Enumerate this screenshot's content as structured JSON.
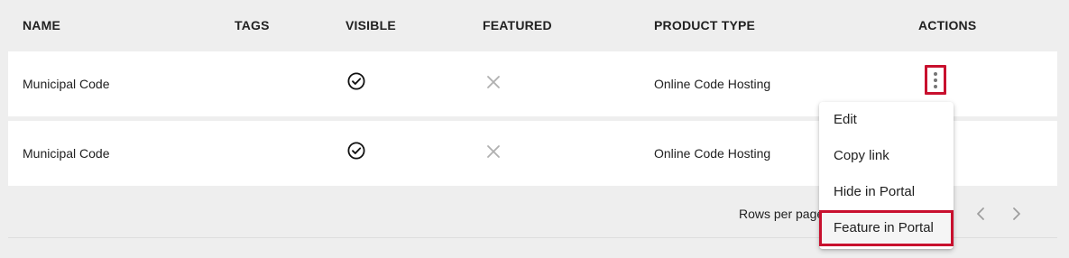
{
  "table": {
    "headers": {
      "name": "NAME",
      "tags": "TAGS",
      "visible": "VISIBLE",
      "featured": "FEATURED",
      "product_type": "PRODUCT TYPE",
      "actions": "ACTIONS"
    },
    "rows": [
      {
        "name": "Municipal Code",
        "tags": "",
        "visible": "check-circle-icon",
        "featured": "close-icon",
        "product_type": "Online Code Hosting"
      },
      {
        "name": "Municipal Code",
        "tags": "",
        "visible": "check-circle-icon",
        "featured": "close-icon",
        "product_type": "Online Code Hosting"
      }
    ]
  },
  "footer": {
    "rows_per_page_label": "Rows per page"
  },
  "actions_menu": {
    "items": [
      "Edit",
      "Copy link",
      "Hide in Portal",
      "Feature in Portal"
    ],
    "highlighted": "Feature in Portal"
  },
  "colors": {
    "highlight_border": "#c8102e",
    "background": "#eeeeee",
    "row_background": "#ffffff"
  }
}
